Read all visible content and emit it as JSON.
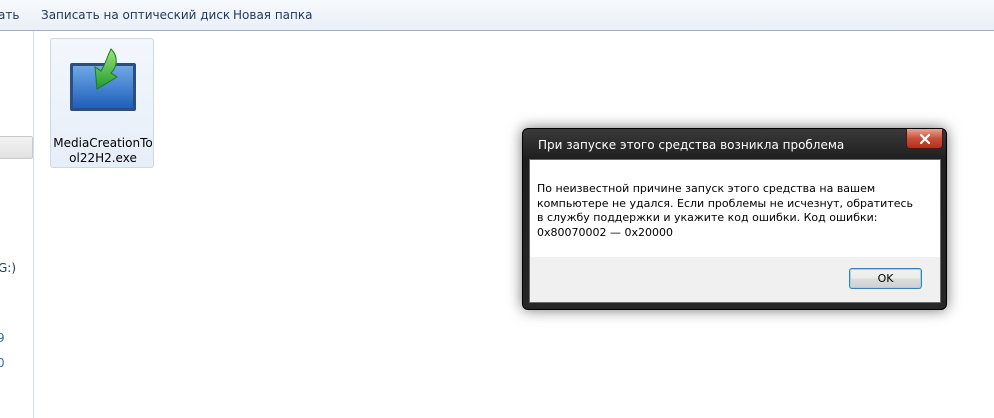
{
  "toolbar": {
    "cut_partial": "ать",
    "burn_label": "Записать на оптический диск",
    "new_folder_label": "Новая папка"
  },
  "nav": {
    "drive_partial": "G:)",
    "text_partial_1": "9",
    "text_partial_2": "0"
  },
  "file": {
    "name_line1": "MediaCreationTo",
    "name_line2": "ol22H2.exe",
    "icon": "media-creation-tool-icon"
  },
  "dialog": {
    "title": "При запуске этого средства возникла проблема",
    "message": "По неизвестной причине запуск этого средства на вашем компьютере не удался. Если проблемы не исчезнут, обратитесь в службу поддержки и укажите код ошибки. Код ошибки: 0x80070002 — 0x20000",
    "ok_label": "OK",
    "close_icon": "close-icon"
  },
  "colors": {
    "toolbar_text": "#1e395b",
    "dialog_frame": "#262626",
    "close_button": "#c7503a",
    "footer": "#f0f0f0"
  }
}
